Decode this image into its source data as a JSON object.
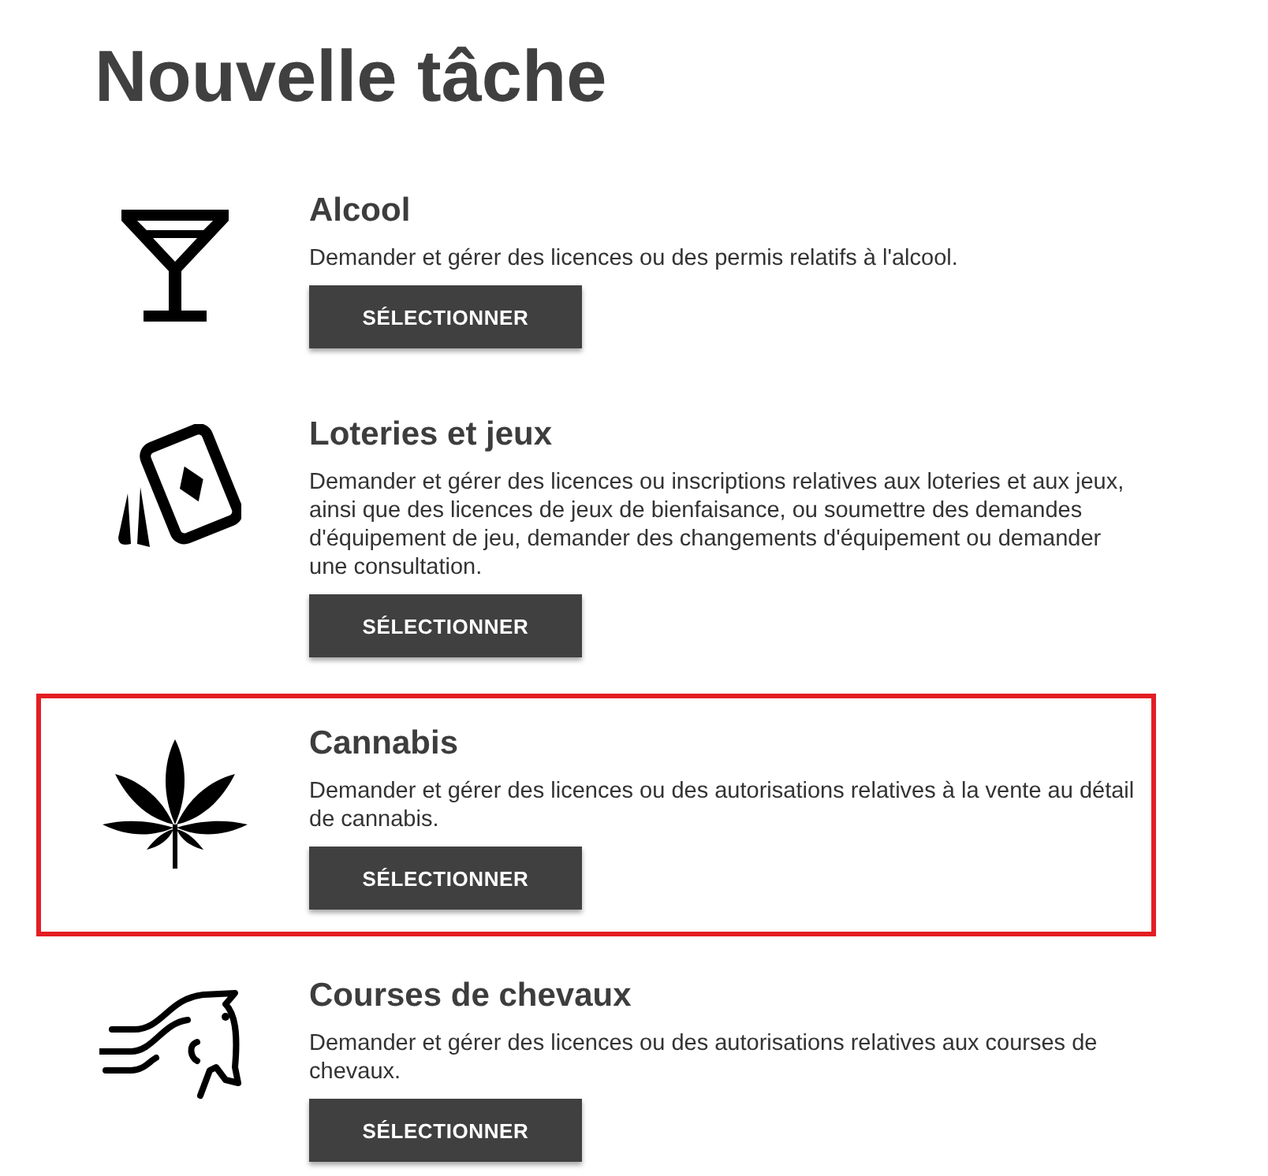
{
  "title": "Nouvelle tâche",
  "tasks": [
    {
      "kind": "alcohol",
      "heading": "Alcool",
      "description": "Demander et gérer des licences ou des permis relatifs à l'alcool.",
      "button": "SÉLECTIONNER",
      "highlighted": false
    },
    {
      "kind": "cards",
      "heading": "Loteries et jeux",
      "description": "Demander et gérer des licences ou inscriptions relatives aux loteries et aux jeux, ainsi que des licences de jeux de bienfaisance, ou soumettre des demandes d'équipement de jeu, demander des changements d'équipement ou demander une consultation.",
      "button": "SÉLECTIONNER",
      "highlighted": false
    },
    {
      "kind": "leaf",
      "heading": "Cannabis",
      "description": "Demander et gérer des licences ou des autorisations relatives à la vente au détail de cannabis.",
      "button": "SÉLECTIONNER",
      "highlighted": true
    },
    {
      "kind": "horse",
      "heading": "Courses de chevaux",
      "description": "Demander et gérer des licences ou des autorisations relatives aux courses de chevaux.",
      "button": "SÉLECTIONNER",
      "highlighted": false
    }
  ]
}
